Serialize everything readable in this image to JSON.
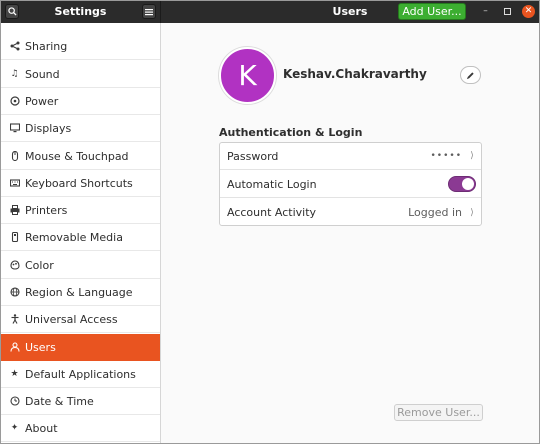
{
  "header": {
    "left_title": "Settings",
    "main_title": "Users",
    "add_user_label": "Add User...",
    "icons": {
      "search": "search-icon",
      "menu": "hamburger-menu-icon",
      "minimize": "minimize-icon",
      "maximize": "maximize-icon",
      "close": "close-icon"
    }
  },
  "sidebar": {
    "items": [
      {
        "label": "Sharing",
        "icon": "share-icon",
        "active": false
      },
      {
        "label": "Sound",
        "icon": "music-note-icon",
        "active": false
      },
      {
        "label": "Power",
        "icon": "power-icon",
        "active": false
      },
      {
        "label": "Displays",
        "icon": "display-icon",
        "active": false
      },
      {
        "label": "Mouse & Touchpad",
        "icon": "mouse-icon",
        "active": false
      },
      {
        "label": "Keyboard Shortcuts",
        "icon": "keyboard-icon",
        "active": false
      },
      {
        "label": "Printers",
        "icon": "printer-icon",
        "active": false
      },
      {
        "label": "Removable Media",
        "icon": "removable-media-icon",
        "active": false
      },
      {
        "label": "Color",
        "icon": "color-icon",
        "active": false
      },
      {
        "label": "Region & Language",
        "icon": "globe-icon",
        "active": false
      },
      {
        "label": "Universal Access",
        "icon": "accessibility-icon",
        "active": false
      },
      {
        "label": "Users",
        "icon": "user-icon",
        "active": true
      },
      {
        "label": "Default Applications",
        "icon": "star-icon",
        "active": false
      },
      {
        "label": "Date & Time",
        "icon": "clock-icon",
        "active": false
      },
      {
        "label": "About",
        "icon": "info-icon",
        "active": false
      }
    ]
  },
  "user": {
    "avatar_letter": "K",
    "name": "Keshav.Chakravarthy"
  },
  "auth": {
    "section_title": "Authentication & Login",
    "rows": {
      "password": {
        "label": "Password",
        "value": "•••••"
      },
      "auto_login": {
        "label": "Automatic Login",
        "enabled": true
      },
      "activity": {
        "label": "Account Activity",
        "value": "Logged in"
      }
    }
  },
  "footer": {
    "remove_user_label": "Remove User..."
  },
  "colors": {
    "accent": "#e95420",
    "add_user": "#3cae31",
    "avatar": "#b132c2",
    "toggle_on": "#8b3a93",
    "headerbar": "#2b2b2b"
  }
}
